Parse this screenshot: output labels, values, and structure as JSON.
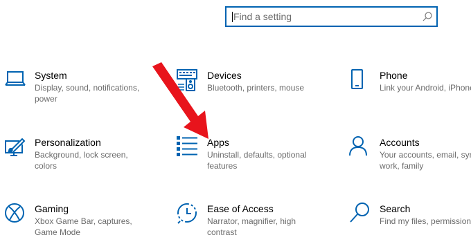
{
  "search": {
    "placeholder": "Find a setting"
  },
  "tiles": [
    {
      "title": "System",
      "desc": "Display, sound, notifications, power",
      "icon": "laptop-icon"
    },
    {
      "title": "Devices",
      "desc": "Bluetooth, printers, mouse",
      "icon": "keyboard-speaker-icon"
    },
    {
      "title": "Phone",
      "desc": "Link your Android, iPhone",
      "icon": "phone-icon"
    },
    {
      "title": "Personalization",
      "desc": "Background, lock screen, colors",
      "icon": "paint-brush-icon"
    },
    {
      "title": "Apps",
      "desc": "Uninstall, defaults, optional features",
      "icon": "apps-list-icon"
    },
    {
      "title": "Accounts",
      "desc": "Your accounts, email, sync, work, family",
      "icon": "person-icon"
    },
    {
      "title": "Gaming",
      "desc": "Xbox Game Bar, captures, Game Mode",
      "icon": "xbox-icon"
    },
    {
      "title": "Ease of Access",
      "desc": "Narrator, magnifier, high contrast",
      "icon": "ease-of-access-icon"
    },
    {
      "title": "Search",
      "desc": "Find my files, permissions",
      "icon": "search-icon"
    }
  ],
  "colors": {
    "accent": "#0063b1",
    "arrow": "#e8141c"
  }
}
